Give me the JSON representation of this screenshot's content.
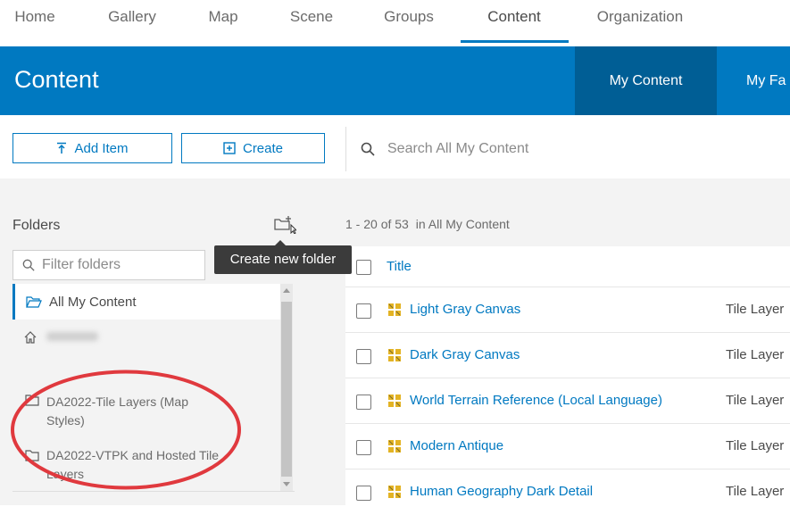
{
  "topnav": {
    "items": [
      {
        "label": "Home"
      },
      {
        "label": "Gallery"
      },
      {
        "label": "Map"
      },
      {
        "label": "Scene"
      },
      {
        "label": "Groups"
      },
      {
        "label": "Content"
      },
      {
        "label": "Organization"
      }
    ],
    "active": "Content"
  },
  "header": {
    "title": "Content",
    "tabs": [
      {
        "label": "My Content"
      },
      {
        "label": "My Fa"
      }
    ]
  },
  "toolbar": {
    "add_item_label": "Add Item",
    "create_label": "Create",
    "search_placeholder": "Search All My Content"
  },
  "sidebar": {
    "folders_label": "Folders",
    "filter_placeholder": "Filter folders",
    "items": [
      {
        "label": "All My Content"
      },
      {
        "label": ""
      },
      {
        "label": "DA2022-Tile Layers (Map Styles)"
      },
      {
        "label": "DA2022-VTPK and Hosted Tile Layers"
      }
    ]
  },
  "tooltip": {
    "text": "Create new folder"
  },
  "results": {
    "count_text": "1 - 20",
    "of_text": "of 53",
    "in_text": "in All My Content",
    "column_title": "Title",
    "rows": [
      {
        "title": "Light Gray Canvas",
        "type": "Tile Layer"
      },
      {
        "title": "Dark Gray Canvas",
        "type": "Tile Layer"
      },
      {
        "title": "World Terrain Reference (Local Language)",
        "type": "Tile Layer"
      },
      {
        "title": "Modern Antique",
        "type": "Tile Layer"
      },
      {
        "title": "Human Geography Dark Detail",
        "type": "Tile Layer"
      }
    ]
  },
  "colors": {
    "accent": "#0079c1",
    "header_active": "#005e95",
    "annotation": "#e0393e"
  }
}
